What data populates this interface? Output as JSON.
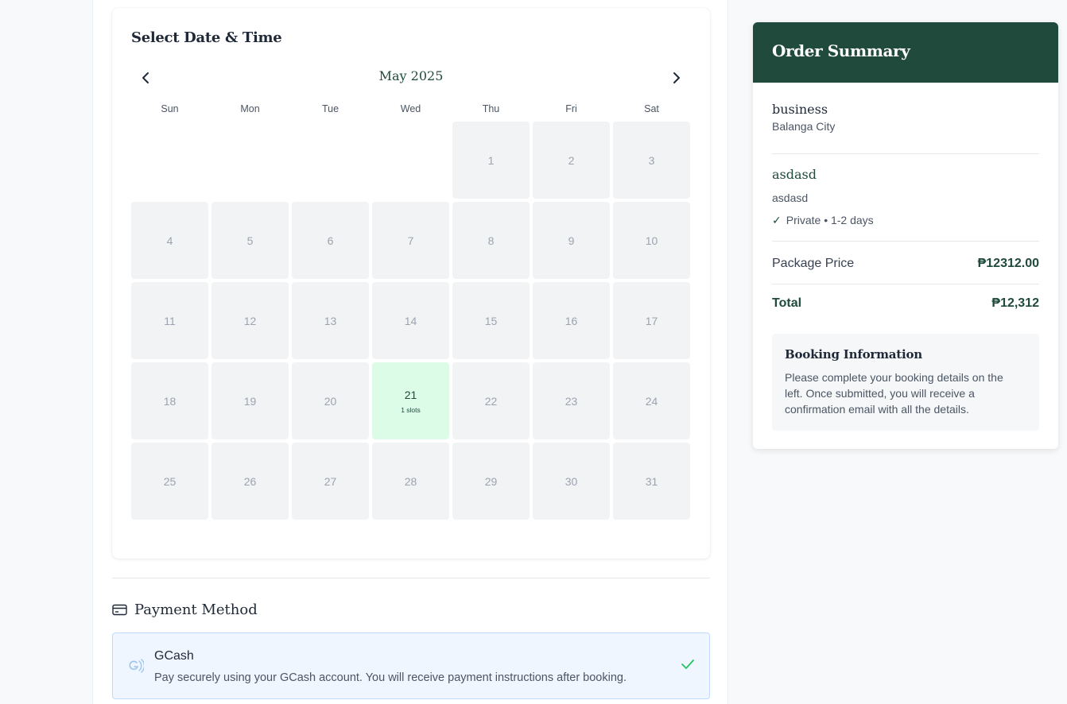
{
  "calendar": {
    "title": "Select Date & Time",
    "month": "May 2025",
    "weekdays": [
      "Sun",
      "Mon",
      "Tue",
      "Wed",
      "Thu",
      "Fri",
      "Sat"
    ],
    "first_weekday_index": 4,
    "days": [
      "1",
      "2",
      "3",
      "4",
      "5",
      "6",
      "7",
      "8",
      "9",
      "10",
      "11",
      "12",
      "13",
      "14",
      "15",
      "16",
      "17",
      "18",
      "19",
      "20",
      "21",
      "22",
      "23",
      "24",
      "25",
      "26",
      "27",
      "28",
      "29",
      "30",
      "31"
    ],
    "selected_day": "21",
    "selected_slots": "1 slots"
  },
  "payment": {
    "heading": "Payment Method",
    "method_name": "GCash",
    "method_desc": "Pay securely using your GCash account. You will receive payment instructions after booking."
  },
  "summary": {
    "title": "Order Summary",
    "business_name": "business",
    "business_location": "Balanga City",
    "package_name": "asdasd",
    "package_desc": "asdasd",
    "package_features": "Private • 1-2 days",
    "package_price_label": "Package Price",
    "package_price": "₱12312.00",
    "total_label": "Total",
    "total": "₱12,312",
    "info_title": "Booking Information",
    "info_text": "Please complete your booking details on the left. Once submitted, you will receive a confirmation email with all the details."
  },
  "colors": {
    "brand": "#1f4a3c",
    "selected_day_bg": "#dcfce7",
    "payment_selected_bg": "#eff6ff"
  }
}
